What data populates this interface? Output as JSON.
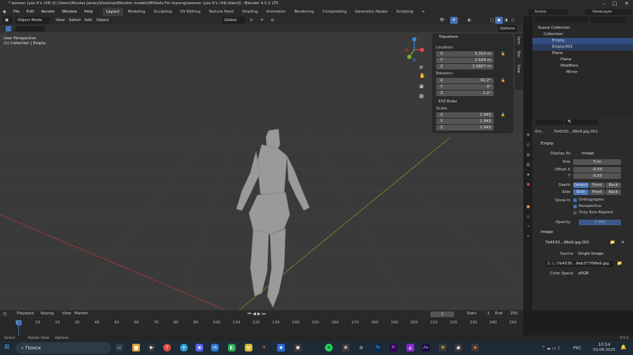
{
  "title": "* women (yes it's r34) [C:\\Users\\Nicolas Janary\\Desktop\\Blender models\\MOdels For leaning\\women (yes it's r34).blend] - Blender 4.5.1 LTS",
  "menu": [
    "File",
    "Edit",
    "Render",
    "Window",
    "Help"
  ],
  "workspaces": [
    "Layout",
    "Modeling",
    "Sculpting",
    "UV Editing",
    "Texture Paint",
    "Shading",
    "Animation",
    "Rendering",
    "Compositing",
    "Geometry Nodes",
    "Scripting"
  ],
  "scene": "Scene",
  "view_layer": "ViewLayer",
  "header": {
    "mode": "Object Mode",
    "view": "View",
    "select": "Select",
    "add": "Add",
    "object": "Object",
    "orientation": "Global",
    "options": "Options"
  },
  "viewport": {
    "line1": "User Perspective",
    "line2": "(1) Collection | Empty"
  },
  "npanel": {
    "title": "Transform",
    "location": "Location:",
    "loc": [
      {
        "ax": "X",
        "v": "5.314 m"
      },
      {
        "ax": "Y",
        "v": "2.634 m"
      },
      {
        "ax": "Z",
        "v": "2.5807 m"
      }
    ],
    "rotation": "Rotation:",
    "rot": [
      {
        "ax": "X",
        "v": "91.2°"
      },
      {
        "ax": "Y",
        "v": "0°"
      },
      {
        "ax": "Z",
        "v": "1.2°"
      }
    ],
    "mode": "XYZ Euler",
    "scale": "Scale:",
    "scl": [
      {
        "ax": "X",
        "v": "1.943"
      },
      {
        "ax": "Y",
        "v": "1.943"
      },
      {
        "ax": "Z",
        "v": "1.943"
      }
    ]
  },
  "side_tabs": [
    "Item",
    "Tool",
    "View"
  ],
  "outliner": {
    "root": "Scene Collection",
    "items": [
      "Collection",
      "Empty",
      "Empty.001",
      "Plane",
      "Plane",
      "Modifiers",
      "Mirror"
    ]
  },
  "props": {
    "name": "Em…",
    "file": "7b4530…98e9.jpg.001",
    "section": "Empty",
    "display_as_label": "Display As",
    "display_as": "Image",
    "size_label": "Size",
    "size": "5 m",
    "offx_label": "Offset X",
    "offx": "-0.50",
    "offy_label": "Y",
    "offy": "-0.50",
    "depth_label": "Depth",
    "depth": [
      "Default",
      "Front",
      "Back"
    ],
    "side_label": "Side",
    "side": [
      "Both",
      "Front",
      "Back"
    ],
    "showin_label": "Show In",
    "ortho": "Orthographic",
    "persp": "Perspective",
    "only_axis": "Only Axis Aligned",
    "opacity_label": "Opacity",
    "opacity": "1.000",
    "image_section": "Image",
    "img_name": "7b4530…98e9.jpg.001",
    "source_label": "Source",
    "source": "Single Image",
    "path": "//..\\..\\7b4530…9eb377f98e9.jpg",
    "cs_label": "Color Space",
    "cs": "sRGB"
  },
  "timeline": {
    "playback": "Playback",
    "keying": "Keying",
    "view": "View",
    "marker": "Marker",
    "frame": "1",
    "start_label": "Start",
    "start": "1",
    "end_label": "End",
    "end": "250",
    "ticks": [
      "0",
      "10",
      "20",
      "30",
      "40",
      "50",
      "60",
      "70",
      "80",
      "90",
      "100",
      "110",
      "120",
      "130",
      "140",
      "150",
      "160",
      "170",
      "180",
      "190",
      "200",
      "210",
      "220",
      "230",
      "240",
      "250"
    ]
  },
  "status": {
    "select": "Select",
    "rotate": "Rotate View",
    "options": "Options",
    "version": "4.5.1"
  },
  "taskbar": {
    "search": "Поиск",
    "lang": "РУС",
    "time": "10:54",
    "date": "03.08.2025"
  }
}
